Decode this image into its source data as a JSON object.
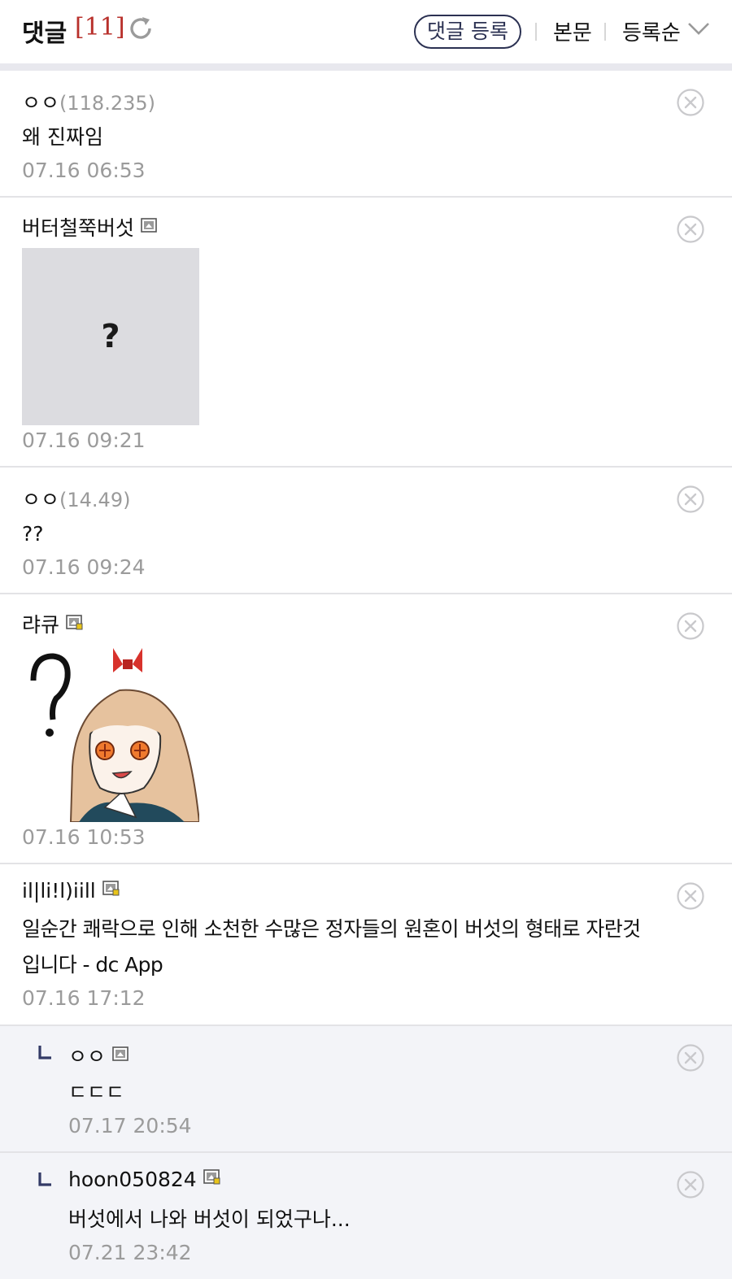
{
  "header": {
    "title": "댓글",
    "count": "[11]",
    "register_button": "댓글 등록",
    "body_link": "본문",
    "sort_label": "등록순"
  },
  "colors": {
    "accent_red": "#b8302b",
    "button_navy": "#2b3152",
    "reply_bg": "#f3f4f8"
  },
  "comments": [
    {
      "nick": "ㅇㅇ",
      "ip": "(118.235)",
      "text": "왜 진짜임",
      "date": "07.16 06:53"
    },
    {
      "nick": "버터철쭉버섯",
      "icon": "gallery-member-icon",
      "image": "?",
      "date": "07.16 09:21"
    },
    {
      "nick": "ㅇㅇ",
      "ip": "(14.49)",
      "text": "??",
      "date": "07.16 09:24"
    },
    {
      "nick": "랴큐",
      "icon": "gallery-fixed-member-icon",
      "image": "confused-anime-girl-sticker",
      "date": "07.16 10:53"
    },
    {
      "nick": "il|li!l)iill",
      "icon": "gallery-fixed-member-icon",
      "text_line1": "일순간 쾌락으로 인해 소천한 수많은 정자들의 원혼이 버섯의 형태로 자란것",
      "text_line2": "입니다 - dc App",
      "date": "07.16 17:12"
    },
    {
      "nick": "ㅇㅇ",
      "icon": "gallery-member-icon",
      "text": "ㄷㄷㄷ",
      "date": "07.17 20:54",
      "reply": true
    },
    {
      "nick": "hoon050824",
      "icon": "gallery-fixed-member-icon",
      "text": "버섯에서 나와 버섯이 되었구나...",
      "date": "07.21 23:42",
      "reply": true
    }
  ]
}
